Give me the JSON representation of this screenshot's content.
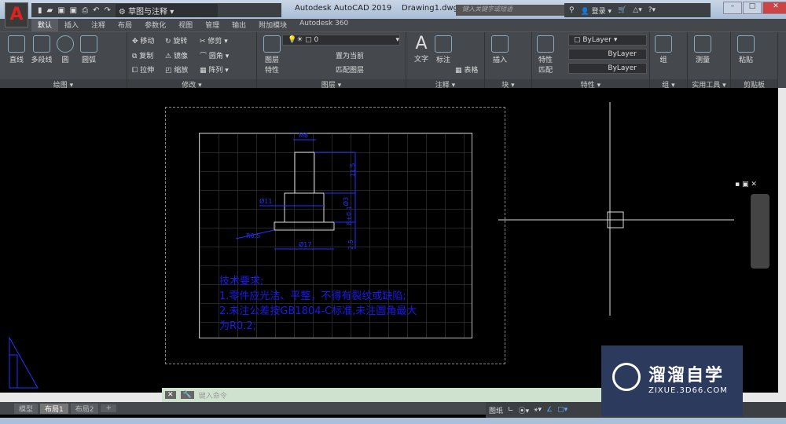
{
  "titlebar": {
    "app_title": "Autodesk AutoCAD 2019",
    "file": "Drawing1.dwg",
    "workspace": "草图与注释",
    "search_placeholder": "键入关键字或短语",
    "login": "登录",
    "logo": "A"
  },
  "tabs": [
    "默认",
    "插入",
    "注释",
    "布局",
    "参数化",
    "视图",
    "管理",
    "输出",
    "附加模块",
    "Autodesk 360"
  ],
  "ribbon": {
    "draw": {
      "label": "绘图",
      "items": [
        "直线",
        "多段线",
        "圆",
        "圆弧"
      ]
    },
    "modify": {
      "label": "修改",
      "items": [
        "移动",
        "旋转",
        "修剪",
        "复制",
        "镜像",
        "圆角",
        "拉伸",
        "缩放",
        "阵列"
      ]
    },
    "layers": {
      "label": "图层",
      "layer_props": "图层\n特性",
      "current_layer": "0",
      "set_current": "置为当前",
      "match_layer": "匹配图层"
    },
    "annotation": {
      "label": "注释",
      "text": "文字",
      "dim": "标注",
      "table": "表格"
    },
    "block": {
      "label": "块",
      "insert": "插入"
    },
    "properties": {
      "label": "特性",
      "match": "特性\n匹配",
      "color": "ByLayer",
      "linetype": "ByLayer",
      "lineweight": "ByLayer"
    },
    "groups": {
      "label": "组",
      "group": "组"
    },
    "utilities": {
      "label": "实用工具",
      "measure": "测量"
    },
    "clipboard": {
      "label": "剪贴板",
      "paste": "粘贴"
    }
  },
  "drawing": {
    "dims": [
      "M6",
      "11.5",
      "Ø11",
      "Ø3",
      "8±0.1",
      "R0.5",
      "Ø17",
      "2.5"
    ],
    "notes": [
      "技术要求:",
      "1.零件应光洁、平整，不得有裂纹或缺陷;",
      "2.未注公差按GB1804-C标准,未注圆角最大",
      "为R0.2;"
    ]
  },
  "command": {
    "placeholder": "键入命令"
  },
  "layout_tabs": [
    "模型",
    "布局1",
    "布局2",
    "+"
  ],
  "status": {
    "paper": "图纸"
  },
  "watermark": {
    "title": "溜溜自学",
    "url": "ZIXUE.3D66.COM"
  },
  "colors": {
    "note": "#1a1aee",
    "dim": "#2233ff",
    "ribbon": "#45484d"
  }
}
